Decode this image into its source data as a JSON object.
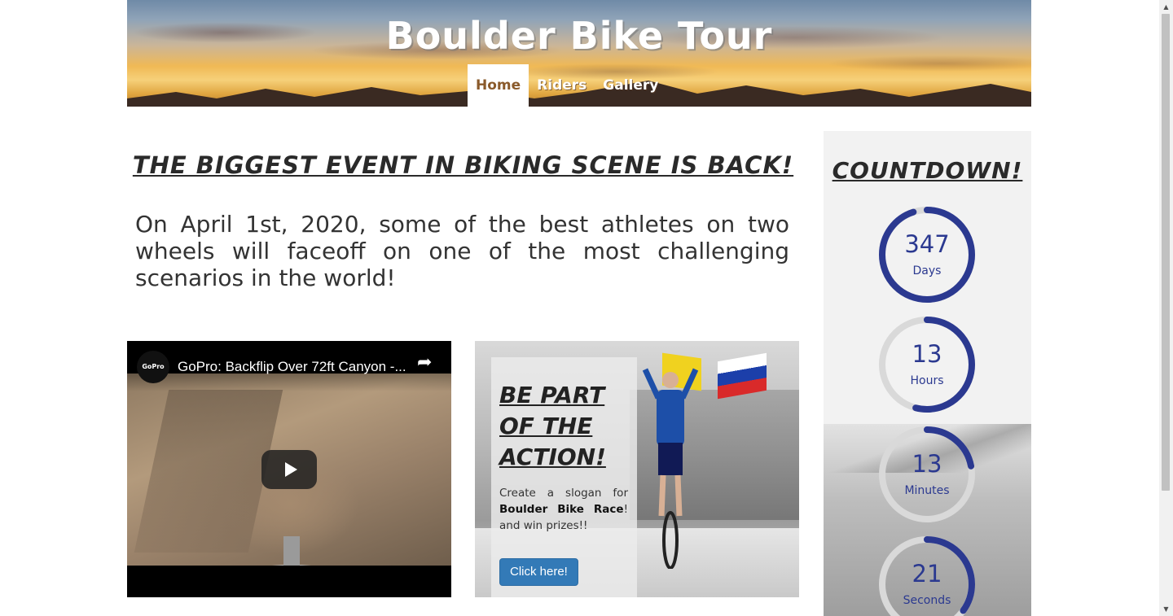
{
  "header": {
    "brand": "Boulder Bike Tour",
    "nav": [
      {
        "label": "Home",
        "active": true
      },
      {
        "label": "Riders",
        "active": false
      },
      {
        "label": "Gallery",
        "active": false
      }
    ]
  },
  "main": {
    "headline": "The Biggest Event in Biking Scene is Back!",
    "intro": "On April 1st, 2020, some of the best athletes on two wheels will faceoff on one of the most challenging scenarios in the world!"
  },
  "video": {
    "channel": "GoPro",
    "title": "GoPro: Backflip Over 72ft Canyon -...",
    "icons": {
      "share": "share-icon",
      "play": "play-icon"
    }
  },
  "promo": {
    "title": "Be Part of the Action!",
    "text_before": "Create a slogan for",
    "text_bold": "Boulder Bike Race",
    "text_after": "! and win prizes!!",
    "button": "Click here!"
  },
  "countdown": {
    "title": "Countdown!",
    "accent_color": "#2b3990",
    "track_color": "#d9d9d9",
    "items": [
      {
        "value": "347",
        "unit": "Days",
        "fraction": 0.95
      },
      {
        "value": "13",
        "unit": "Hours",
        "fraction": 0.54
      },
      {
        "value": "13",
        "unit": "Minutes",
        "fraction": 0.22
      },
      {
        "value": "21",
        "unit": "Seconds",
        "fraction": 0.35
      }
    ]
  }
}
